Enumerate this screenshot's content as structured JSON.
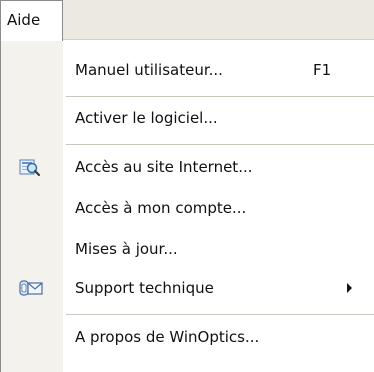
{
  "menubar": {
    "active_menu": "Aide"
  },
  "menu": {
    "items": [
      {
        "label": "Manuel utilisateur...",
        "shortcut": "F1"
      },
      {
        "label": "Activer le logiciel..."
      },
      {
        "label": "Accès au site Internet...",
        "icon": "globe-search-icon"
      },
      {
        "label": "Accès à mon compte..."
      },
      {
        "label": "Mises à jour..."
      },
      {
        "label": "Support technique",
        "icon": "support-envelope-icon",
        "has_submenu": true
      },
      {
        "label": "A propos de WinOptics..."
      }
    ]
  }
}
